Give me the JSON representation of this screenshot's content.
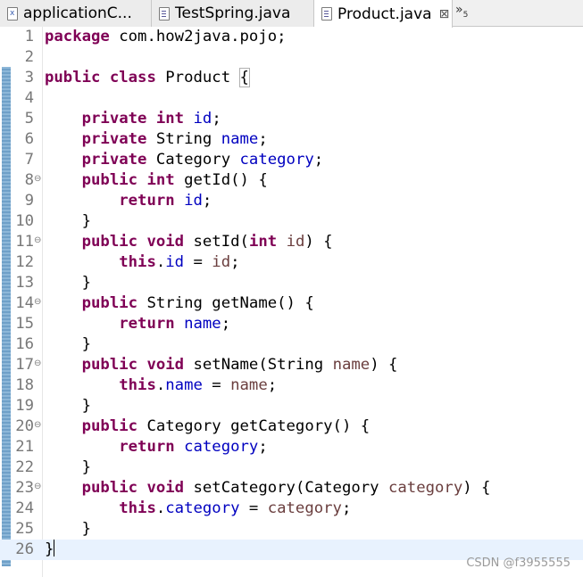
{
  "tabs": [
    {
      "label": "applicationC...",
      "icon": "xml-file-icon",
      "active": false,
      "closable": false
    },
    {
      "label": "TestSpring.java",
      "icon": "java-file-icon",
      "active": false,
      "closable": false
    },
    {
      "label": "Product.java",
      "icon": "java-file-icon",
      "active": true,
      "closable": true,
      "close_glyph": "⊠"
    }
  ],
  "overflow": {
    "glyph": "»",
    "count": "5"
  },
  "editor": {
    "current_line": 26,
    "folded_lines": [
      8,
      11,
      14,
      17,
      20,
      23
    ],
    "lines": [
      [
        {
          "t": "kw",
          "v": "package"
        },
        {
          "t": "txt",
          "v": " com.how2java.pojo;"
        }
      ],
      [],
      [
        {
          "t": "kw",
          "v": "public"
        },
        {
          "t": "txt",
          "v": " "
        },
        {
          "t": "kw",
          "v": "class"
        },
        {
          "t": "txt",
          "v": " Product "
        },
        {
          "t": "brace",
          "v": "{"
        }
      ],
      [],
      [
        {
          "t": "txt",
          "v": "    "
        },
        {
          "t": "kw",
          "v": "private"
        },
        {
          "t": "txt",
          "v": " "
        },
        {
          "t": "kw",
          "v": "int"
        },
        {
          "t": "txt",
          "v": " "
        },
        {
          "t": "fld",
          "v": "id"
        },
        {
          "t": "txt",
          "v": ";"
        }
      ],
      [
        {
          "t": "txt",
          "v": "    "
        },
        {
          "t": "kw",
          "v": "private"
        },
        {
          "t": "txt",
          "v": " String "
        },
        {
          "t": "fld",
          "v": "name"
        },
        {
          "t": "txt",
          "v": ";"
        }
      ],
      [
        {
          "t": "txt",
          "v": "    "
        },
        {
          "t": "kw",
          "v": "private"
        },
        {
          "t": "txt",
          "v": " Category "
        },
        {
          "t": "fld",
          "v": "category"
        },
        {
          "t": "txt",
          "v": ";"
        }
      ],
      [
        {
          "t": "txt",
          "v": "    "
        },
        {
          "t": "kw",
          "v": "public"
        },
        {
          "t": "txt",
          "v": " "
        },
        {
          "t": "kw",
          "v": "int"
        },
        {
          "t": "txt",
          "v": " getId() {"
        }
      ],
      [
        {
          "t": "txt",
          "v": "        "
        },
        {
          "t": "kw",
          "v": "return"
        },
        {
          "t": "txt",
          "v": " "
        },
        {
          "t": "fld",
          "v": "id"
        },
        {
          "t": "txt",
          "v": ";"
        }
      ],
      [
        {
          "t": "txt",
          "v": "    }"
        }
      ],
      [
        {
          "t": "txt",
          "v": "    "
        },
        {
          "t": "kw",
          "v": "public"
        },
        {
          "t": "txt",
          "v": " "
        },
        {
          "t": "kw",
          "v": "void"
        },
        {
          "t": "txt",
          "v": " setId("
        },
        {
          "t": "kw",
          "v": "int"
        },
        {
          "t": "txt",
          "v": " "
        },
        {
          "t": "var",
          "v": "id"
        },
        {
          "t": "txt",
          "v": ") {"
        }
      ],
      [
        {
          "t": "txt",
          "v": "        "
        },
        {
          "t": "kw",
          "v": "this"
        },
        {
          "t": "txt",
          "v": "."
        },
        {
          "t": "fld",
          "v": "id"
        },
        {
          "t": "txt",
          "v": " = "
        },
        {
          "t": "var",
          "v": "id"
        },
        {
          "t": "txt",
          "v": ";"
        }
      ],
      [
        {
          "t": "txt",
          "v": "    }"
        }
      ],
      [
        {
          "t": "txt",
          "v": "    "
        },
        {
          "t": "kw",
          "v": "public"
        },
        {
          "t": "txt",
          "v": " String getName() {"
        }
      ],
      [
        {
          "t": "txt",
          "v": "        "
        },
        {
          "t": "kw",
          "v": "return"
        },
        {
          "t": "txt",
          "v": " "
        },
        {
          "t": "fld",
          "v": "name"
        },
        {
          "t": "txt",
          "v": ";"
        }
      ],
      [
        {
          "t": "txt",
          "v": "    }"
        }
      ],
      [
        {
          "t": "txt",
          "v": "    "
        },
        {
          "t": "kw",
          "v": "public"
        },
        {
          "t": "txt",
          "v": " "
        },
        {
          "t": "kw",
          "v": "void"
        },
        {
          "t": "txt",
          "v": " setName(String "
        },
        {
          "t": "var",
          "v": "name"
        },
        {
          "t": "txt",
          "v": ") {"
        }
      ],
      [
        {
          "t": "txt",
          "v": "        "
        },
        {
          "t": "kw",
          "v": "this"
        },
        {
          "t": "txt",
          "v": "."
        },
        {
          "t": "fld",
          "v": "name"
        },
        {
          "t": "txt",
          "v": " = "
        },
        {
          "t": "var",
          "v": "name"
        },
        {
          "t": "txt",
          "v": ";"
        }
      ],
      [
        {
          "t": "txt",
          "v": "    }"
        }
      ],
      [
        {
          "t": "txt",
          "v": "    "
        },
        {
          "t": "kw",
          "v": "public"
        },
        {
          "t": "txt",
          "v": " Category getCategory() {"
        }
      ],
      [
        {
          "t": "txt",
          "v": "        "
        },
        {
          "t": "kw",
          "v": "return"
        },
        {
          "t": "txt",
          "v": " "
        },
        {
          "t": "fld",
          "v": "category"
        },
        {
          "t": "txt",
          "v": ";"
        }
      ],
      [
        {
          "t": "txt",
          "v": "    }"
        }
      ],
      [
        {
          "t": "txt",
          "v": "    "
        },
        {
          "t": "kw",
          "v": "public"
        },
        {
          "t": "txt",
          "v": " "
        },
        {
          "t": "kw",
          "v": "void"
        },
        {
          "t": "txt",
          "v": " setCategory(Category "
        },
        {
          "t": "var",
          "v": "category"
        },
        {
          "t": "txt",
          "v": ") {"
        }
      ],
      [
        {
          "t": "txt",
          "v": "        "
        },
        {
          "t": "kw",
          "v": "this"
        },
        {
          "t": "txt",
          "v": "."
        },
        {
          "t": "fld",
          "v": "category"
        },
        {
          "t": "txt",
          "v": " = "
        },
        {
          "t": "var",
          "v": "category"
        },
        {
          "t": "txt",
          "v": ";"
        }
      ],
      [
        {
          "t": "txt",
          "v": "    }"
        }
      ],
      [
        {
          "t": "brace",
          "v": "}"
        },
        {
          "t": "caret",
          "v": ""
        }
      ]
    ]
  },
  "colors": {
    "keyword": "#7f0055",
    "field": "#0000c0",
    "variable": "#6a3e3e",
    "current_line": "#e8f2fe"
  },
  "watermark": "CSDN @f3955555"
}
